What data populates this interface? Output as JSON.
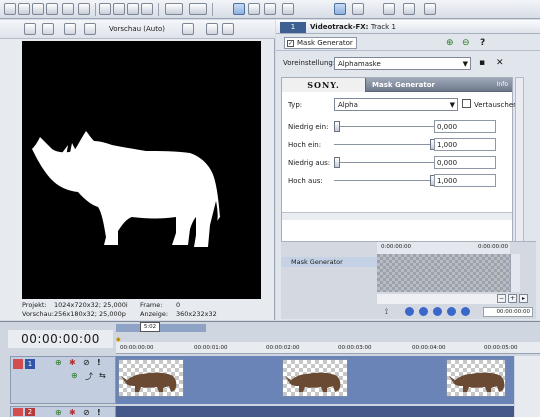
{
  "toolbar": {
    "icons": [
      "new-icon",
      "open-icon",
      "save-icon",
      "save-as-icon",
      "properties-icon",
      "render-icon",
      "cut-icon",
      "copy-icon",
      "paste-icon",
      "delete-icon",
      "undo-icon",
      "redo-icon",
      "normal-edit-tool-icon",
      "envelope-tool-icon",
      "selection-tool-icon",
      "zoom-tool-icon",
      "auto-ripple-icon",
      "lock-envelopes-icon",
      "snap-icon",
      "help-icon"
    ]
  },
  "preview": {
    "mode_label": "Vorschau (Auto)",
    "info": {
      "project_label": "Projekt:",
      "project_value": "1024x720x32; 25,000i",
      "frame_label": "Frame:",
      "frame_value": "0",
      "preview_label": "Vorschau:",
      "preview_value": "256x180x32; 25,000p",
      "display_label": "Anzeige:",
      "display_value": "360x232x32"
    }
  },
  "fx": {
    "tab_label": "1",
    "title": "Videotrack-FX:",
    "title_track": "Track 1",
    "chain_item": "Mask Generator",
    "preset_label": "Voreinstellung:",
    "preset_value": "Alphamaske",
    "plugin": {
      "brand": "SONY.",
      "name": "Mask Generator",
      "info": "Info",
      "type_label": "Typ:",
      "type_value": "Alpha",
      "invert_label": "Vertauschen",
      "params": [
        {
          "label": "Niedrig ein:",
          "value": "0,000",
          "level": 0.0
        },
        {
          "label": "Hoch ein:",
          "value": "1,000",
          "level": 1.0
        },
        {
          "label": "Niedrig aus:",
          "value": "0,000",
          "level": 0.0
        },
        {
          "label": "Hoch aus:",
          "value": "1,000",
          "level": 1.0
        }
      ]
    },
    "keyframe": {
      "row_label": "Mask Generator",
      "ruler_start": "0:00:00:00",
      "ruler_end": "0:00:00:00",
      "time_value": "00:00:00:00"
    }
  },
  "timeline": {
    "time": "00:00:00:00",
    "loop_label": "5:02",
    "ruler": [
      "00:00:00:00",
      "00:00:01:00",
      "00:00:02:00",
      "00:00:03:00",
      "00:00:04:00",
      "00:00:05:00"
    ],
    "track1_number": "1",
    "track2_number": "2"
  },
  "colors": {
    "accent": "#3d5f92",
    "track_lane": "#6a84b8",
    "preview_bg": "#000000"
  }
}
